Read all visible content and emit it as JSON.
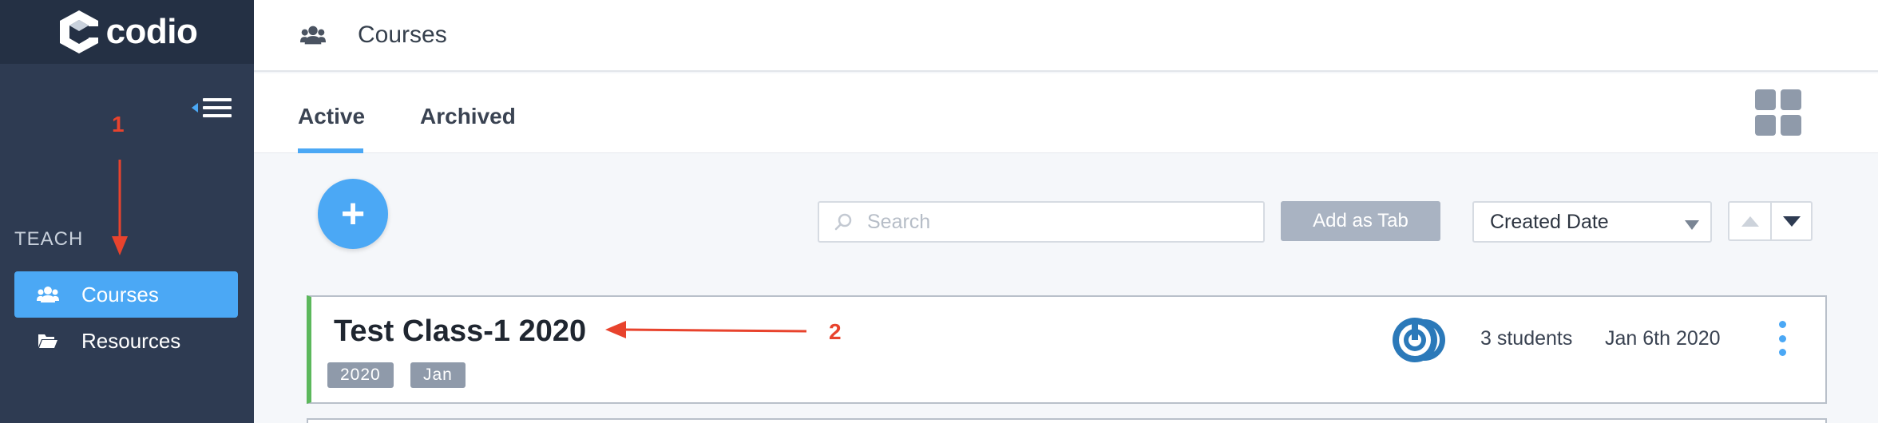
{
  "app": {
    "brand": "codio"
  },
  "sidebar": {
    "section_label": "TEACH",
    "items": [
      {
        "label": "Courses",
        "icon": "users-icon",
        "active": true
      },
      {
        "label": "Resources",
        "icon": "folder-icon",
        "active": false
      }
    ]
  },
  "header": {
    "title": "Courses",
    "icon": "users-icon"
  },
  "tabs": [
    {
      "label": "Active",
      "active": true
    },
    {
      "label": "Archived",
      "active": false
    }
  ],
  "toolbar": {
    "add_symbol": "+",
    "search_placeholder": "Search",
    "add_as_tab_label": "Add as Tab",
    "sort_selected": "Created Date"
  },
  "courses": [
    {
      "title": "Test Class-1 2020",
      "tags": [
        "2020",
        "Jan"
      ],
      "students": "3 students",
      "date": "Jan 6th 2020"
    }
  ],
  "annotations": [
    {
      "label": "1"
    },
    {
      "label": "2"
    }
  ],
  "colors": {
    "sidebar_bg": "#2e3b52",
    "accent": "#4ba8f5",
    "course_accent": "#5cb85c",
    "annotation": "#e8432d"
  }
}
